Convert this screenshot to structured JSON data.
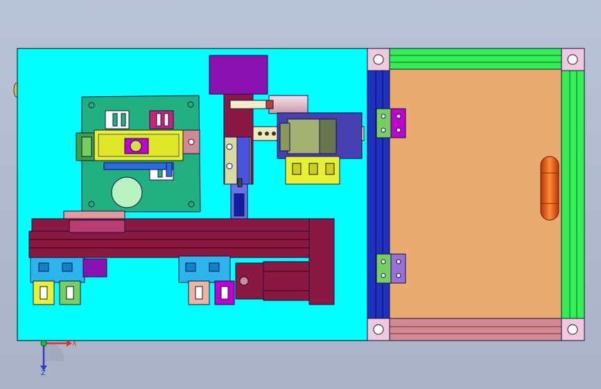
{
  "triad": {
    "x_label": "X",
    "z_label": "Z"
  },
  "colors": {
    "background_top": "#b9c3d6",
    "base_plate": "#00ffff",
    "door_panel": "#e8ab70",
    "frame_green": "#33ee55",
    "frame_blue": "#2030c0",
    "frame_pink": "#d28a92",
    "rail_maroon": "#8a1840",
    "motor_purple": "#8a12b0",
    "circuit_board": "#22b080",
    "clamp_yellow": "#eaf032",
    "profile_blue": "#2cb4ee",
    "handle_orange": "#e85a10"
  }
}
